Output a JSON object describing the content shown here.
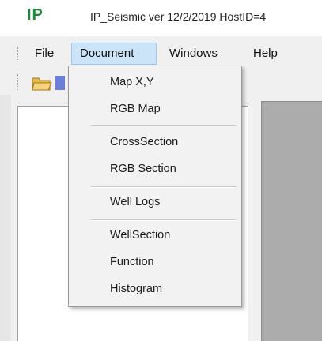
{
  "title_bar": {
    "logo": "IP",
    "title": "IP_Seismic ver 12/2/2019   HostID=4"
  },
  "menubar": {
    "items": [
      {
        "label": "File"
      },
      {
        "label": "Document"
      },
      {
        "label": "Windows"
      },
      {
        "label": "Help"
      }
    ]
  },
  "dropdown": {
    "items": [
      {
        "label": "Map X,Y"
      },
      {
        "label": "RGB Map"
      },
      {
        "label": "CrossSection"
      },
      {
        "label": "RGB Section"
      },
      {
        "label": "Well Logs"
      },
      {
        "label": "WellSection"
      },
      {
        "label": "Function"
      },
      {
        "label": "Histogram"
      }
    ]
  },
  "toolbar": {
    "icons": [
      "open-folder-icon",
      "tool-icon"
    ]
  },
  "colors": {
    "logo": "#1f8a3a",
    "menu_highlight": "#cce4f7",
    "gray_panel": "#acacac"
  }
}
